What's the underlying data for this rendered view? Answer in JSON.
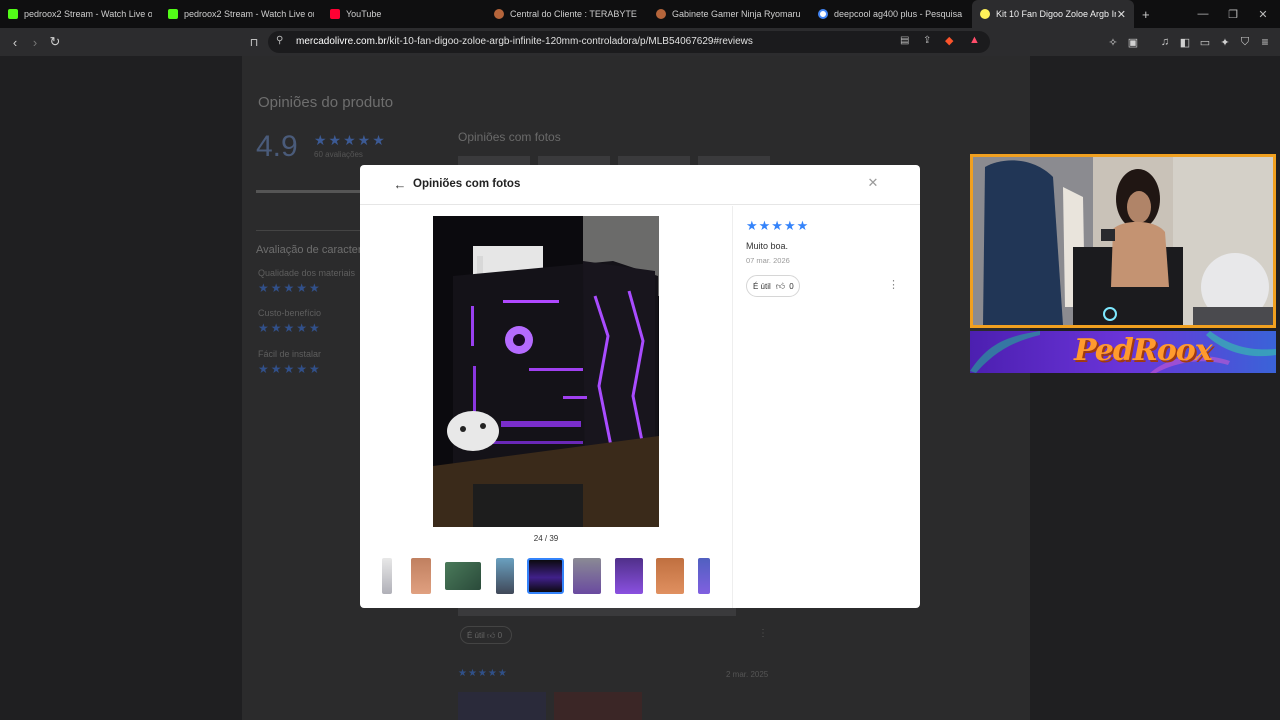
{
  "browser": {
    "tabs": [
      {
        "title": "pedroox2 Stream - Watch Live o",
        "favicon_color": "#53fc18",
        "active": false
      },
      {
        "title": "pedroox2 Stream - Watch Live on Ki",
        "favicon_color": "#53fc18",
        "active": false
      },
      {
        "title": "YouTube",
        "favicon_color": "#ff0033",
        "active": false
      },
      {
        "title": "Central do Cliente : TERABYTE",
        "favicon_color": "#b5653b",
        "active": false
      },
      {
        "title": "Gabinete Gamer Ninja Ryomaru mAT",
        "favicon_color": "#b5653b",
        "active": false
      },
      {
        "title": "deepcool ag400 plus - Pesquisa Goo",
        "favicon_color": "#ffffff",
        "active": false
      },
      {
        "title": "Kit 10 Fan Digoo Zoloe Argb Infi",
        "favicon_color": "#fff159",
        "active": true
      }
    ],
    "new_tab_label": "+",
    "url_host": "mercadolivre.com.br",
    "url_path": "/kit-10-fan-digoo-zoloe-argb-infinite-120mm-controladora/p/MLB54067629#reviews"
  },
  "background_page": {
    "section_title": "Opiniões do produto",
    "score": "4.9",
    "stars": "★★★★★",
    "rating_count": "60 avaliações",
    "photos_heading": "Opiniões com fotos",
    "features_title": "Avaliação de caracter",
    "features": [
      {
        "label": "Qualidade dos materiais",
        "stars": "★★★★★"
      },
      {
        "label": "Custo-benefício",
        "stars": "★★★★★"
      },
      {
        "label": "Fácil de instalar",
        "stars": "★★★★★"
      }
    ],
    "util_label": "É útil",
    "util_count": "0",
    "next_review_stars": "★★★★★",
    "next_review_date": "2 mar. 2025"
  },
  "modal": {
    "title": "Opiniões com fotos",
    "counter": "24 / 39",
    "review": {
      "stars": "★★★★★",
      "rating": 5,
      "text": "Muito boa.",
      "date": "07 mar. 2026",
      "util_label": "É útil",
      "util_count": "0"
    },
    "star_color": "#3483fa",
    "thumbnails": [
      {
        "desc": "bright-room"
      },
      {
        "desc": "orange-case"
      },
      {
        "desc": "green-board"
      },
      {
        "desc": "blue-light"
      },
      {
        "desc": "purple-pc",
        "selected": true
      },
      {
        "desc": "purple-case"
      },
      {
        "desc": "purple-fan"
      },
      {
        "desc": "orange-light"
      },
      {
        "desc": "blue-purple"
      }
    ]
  },
  "stream_overlay": {
    "channel_name": "PedRoox",
    "accent_color": "#f0a020"
  }
}
